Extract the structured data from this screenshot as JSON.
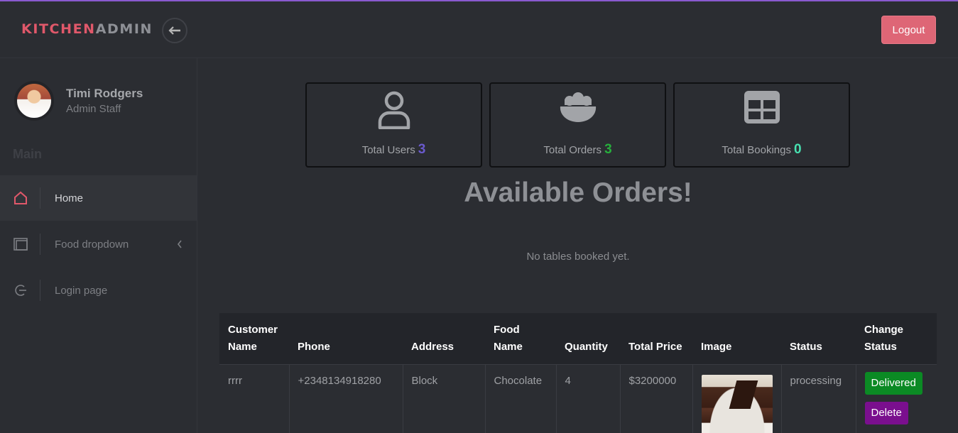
{
  "header": {
    "brand_part1": "KITCHEN",
    "brand_part2": "ADMIN",
    "back_icon": "arrow-left-icon",
    "logout_label": "Logout"
  },
  "sidebar": {
    "user": {
      "name": "Timi Rodgers",
      "role": "Admin Staff"
    },
    "section_title": "Main",
    "items": [
      {
        "label": "Home",
        "icon": "home-icon",
        "active": true
      },
      {
        "label": "Food dropdown",
        "icon": "window-icon",
        "has_caret": true
      },
      {
        "label": "Login page",
        "icon": "logout-circle-icon"
      }
    ]
  },
  "stats": [
    {
      "label": "Total Users",
      "value": "3",
      "icon": "user-icon",
      "color": "#6a5acd"
    },
    {
      "label": "Total Orders",
      "value": "3",
      "icon": "bowl-icon",
      "color": "#27ae3c"
    },
    {
      "label": "Total Bookings",
      "value": "0",
      "icon": "table-grid-icon",
      "color": "#47e0b0"
    }
  ],
  "main": {
    "heading": "Available Orders!",
    "empty_message": "No tables booked yet."
  },
  "orders_table": {
    "columns": [
      "Customer Name",
      "Phone",
      "Address",
      "Food Name",
      "Quantity",
      "Total Price",
      "Image",
      "Status",
      "Change Status"
    ],
    "rows": [
      {
        "customer": "rrrr",
        "phone": "+2348134918280",
        "address": "Block",
        "food": "Chocolate",
        "quantity": "4",
        "price": "$3200000",
        "image": "chocolate-cake",
        "status": "processing",
        "deliver_label": "Delivered",
        "delete_label": "Delete"
      }
    ]
  },
  "colors": {
    "accent": "#e0586a",
    "background": "#2b2d32",
    "deliver": "#0b8a24",
    "delete": "#7a0f8e"
  }
}
